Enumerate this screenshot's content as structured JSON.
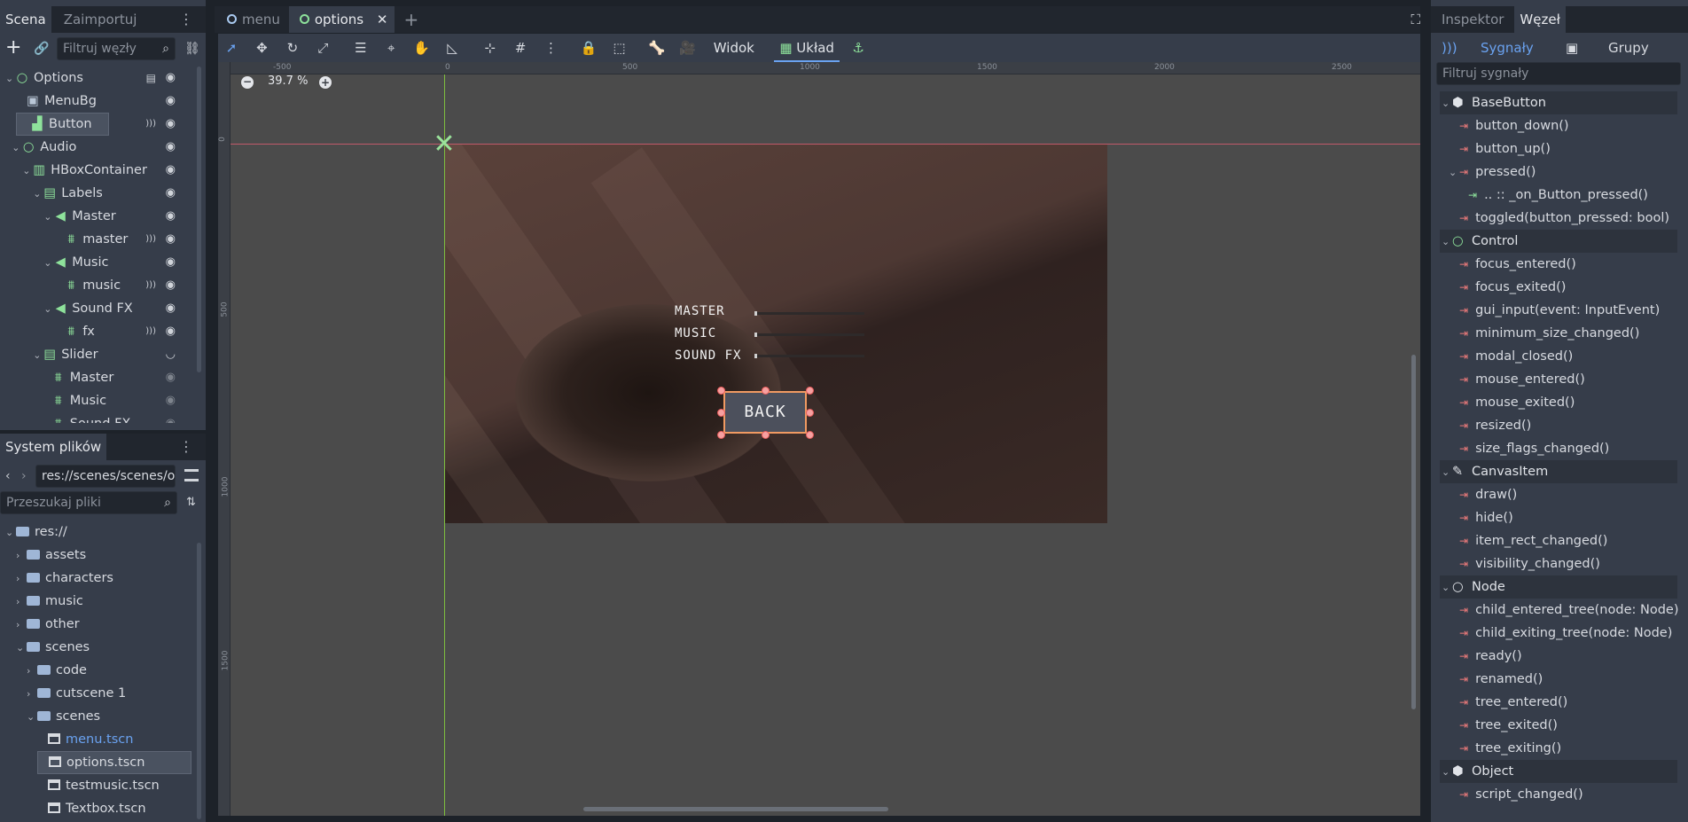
{
  "scene_dock": {
    "tabs": [
      "Scena",
      "Zaimportuj"
    ],
    "filter_placeholder": "Filtruj węzły",
    "tree": [
      {
        "label": "Options",
        "indent": 0,
        "icon": "control-node-icon",
        "arrow": "⌄",
        "sig": false,
        "eye": true,
        "script": true
      },
      {
        "label": "MenuBg",
        "indent": 1,
        "icon": "texture-rect-icon",
        "arrow": "",
        "sig": false,
        "eye": true
      },
      {
        "label": "Button",
        "indent": 1,
        "icon": "button-node-icon",
        "arrow": "",
        "sig": true,
        "eye": true,
        "selected": true
      },
      {
        "label": "Audio",
        "indent": 0.6,
        "icon": "control-node-icon",
        "arrow": "⌄",
        "sig": false,
        "eye": true
      },
      {
        "label": "HBoxContainer",
        "indent": 1.6,
        "icon": "hbox-icon",
        "arrow": "⌄",
        "sig": false,
        "eye": true
      },
      {
        "label": "Labels",
        "indent": 2.6,
        "icon": "vbox-icon",
        "arrow": "⌄",
        "sig": false,
        "eye": true
      },
      {
        "label": "Master",
        "indent": 3.6,
        "icon": "label-node-icon",
        "arrow": "⌄",
        "sig": false,
        "eye": true
      },
      {
        "label": "master",
        "indent": 4.6,
        "icon": "audio-player-icon",
        "arrow": "",
        "sig": true,
        "eye": true
      },
      {
        "label": "Music",
        "indent": 3.6,
        "icon": "label-node-icon",
        "arrow": "⌄",
        "sig": false,
        "eye": true
      },
      {
        "label": "music",
        "indent": 4.6,
        "icon": "audio-player-icon",
        "arrow": "",
        "sig": true,
        "eye": true
      },
      {
        "label": "Sound FX",
        "indent": 3.6,
        "icon": "label-node-icon",
        "arrow": "⌄",
        "sig": false,
        "eye": true
      },
      {
        "label": "fx",
        "indent": 4.6,
        "icon": "audio-player-icon",
        "arrow": "",
        "sig": true,
        "eye": true
      },
      {
        "label": "Slider",
        "indent": 2.6,
        "icon": "vbox-icon",
        "arrow": "⌄",
        "sig": false,
        "eye": false,
        "hidden_toggle": true
      },
      {
        "label": "Master",
        "indent": 3.4,
        "icon": "slider-icon",
        "arrow": "",
        "sig": false,
        "eye": true,
        "dim": true
      },
      {
        "label": "Music",
        "indent": 3.4,
        "icon": "slider-icon",
        "arrow": "",
        "sig": false,
        "eye": true,
        "dim": true
      },
      {
        "label": "Sound FX",
        "indent": 3.4,
        "icon": "slider-icon",
        "arrow": "",
        "sig": false,
        "eye": true,
        "dim": true
      }
    ]
  },
  "filesystem": {
    "tab": "System plików",
    "path": "res://scenes/scenes/o",
    "search_placeholder": "Przeszukaj pliki",
    "items": [
      {
        "label": "res://",
        "indent": 0,
        "type": "folder",
        "arrow": "⌄"
      },
      {
        "label": "assets",
        "indent": 1,
        "type": "folder",
        "arrow": "›"
      },
      {
        "label": "characters",
        "indent": 1,
        "type": "folder",
        "arrow": "›"
      },
      {
        "label": "music",
        "indent": 1,
        "type": "folder",
        "arrow": "›"
      },
      {
        "label": "other",
        "indent": 1,
        "type": "folder",
        "arrow": "›"
      },
      {
        "label": "scenes",
        "indent": 1,
        "type": "folder",
        "arrow": "⌄"
      },
      {
        "label": "code",
        "indent": 2,
        "type": "folder",
        "arrow": "›"
      },
      {
        "label": "cutscene 1",
        "indent": 2,
        "type": "folder",
        "arrow": "›"
      },
      {
        "label": "scenes",
        "indent": 2,
        "type": "folder",
        "arrow": "⌄"
      },
      {
        "label": "menu.tscn",
        "indent": 3,
        "type": "scene",
        "arrow": "",
        "highlight": true
      },
      {
        "label": "options.tscn",
        "indent": 3,
        "type": "scene",
        "arrow": "",
        "selected": true
      },
      {
        "label": "testmusic.tscn",
        "indent": 3,
        "type": "scene",
        "arrow": ""
      },
      {
        "label": "Textbox.tscn",
        "indent": 3,
        "type": "scene",
        "arrow": ""
      }
    ]
  },
  "editor": {
    "tabs": [
      {
        "label": "menu",
        "active": false
      },
      {
        "label": "options",
        "active": true
      }
    ],
    "toolbar": {
      "view_label": "Widok",
      "layout_label": "Układ"
    },
    "zoom": "39.7 %",
    "ruler_x": [
      "-500",
      "0",
      "500",
      "1000",
      "1500",
      "2000",
      "2500"
    ],
    "ruler_y": [
      "0",
      "500",
      "1000",
      "1500"
    ],
    "game_ui": {
      "labels": [
        "MASTER",
        "MUSIC",
        "SOUND FX"
      ],
      "back_button": "BACK"
    }
  },
  "node_dock": {
    "top_tabs": [
      "Inspektor",
      "Węzeł"
    ],
    "sub_tabs": [
      "Sygnały",
      "Grupy"
    ],
    "filter_placeholder": "Filtruj sygnały",
    "sections": [
      {
        "title": "BaseButton",
        "icon": "cube-icon",
        "signals": [
          {
            "label": "button_down()"
          },
          {
            "label": "button_up()"
          },
          {
            "label": "pressed()",
            "expanded": true
          },
          {
            "label": ".. :: _on_Button_pressed()",
            "connection": true
          },
          {
            "label": "toggled(button_pressed: bool)"
          }
        ]
      },
      {
        "title": "Control",
        "icon": "circle-icon",
        "signals": [
          {
            "label": "focus_entered()"
          },
          {
            "label": "focus_exited()"
          },
          {
            "label": "gui_input(event: InputEvent)"
          },
          {
            "label": "minimum_size_changed()"
          },
          {
            "label": "modal_closed()"
          },
          {
            "label": "mouse_entered()"
          },
          {
            "label": "mouse_exited()"
          },
          {
            "label": "resized()"
          },
          {
            "label": "size_flags_changed()"
          }
        ]
      },
      {
        "title": "CanvasItem",
        "icon": "brush-icon",
        "signals": [
          {
            "label": "draw()"
          },
          {
            "label": "hide()"
          },
          {
            "label": "item_rect_changed()"
          },
          {
            "label": "visibility_changed()"
          }
        ]
      },
      {
        "title": "Node",
        "icon": "circle-icon",
        "signals": [
          {
            "label": "child_entered_tree(node: Node)"
          },
          {
            "label": "child_exiting_tree(node: Node)"
          },
          {
            "label": "ready()"
          },
          {
            "label": "renamed()"
          },
          {
            "label": "tree_entered()"
          },
          {
            "label": "tree_exited()"
          },
          {
            "label": "tree_exiting()"
          }
        ]
      },
      {
        "title": "Object",
        "icon": "cube-icon",
        "signals": [
          {
            "label": "script_changed()"
          }
        ]
      }
    ]
  },
  "colors": {
    "accent": "#6aa2f0",
    "node_green": "#8ee29b",
    "signal_red": "#ef7b7b",
    "selection": "#f09a62"
  }
}
